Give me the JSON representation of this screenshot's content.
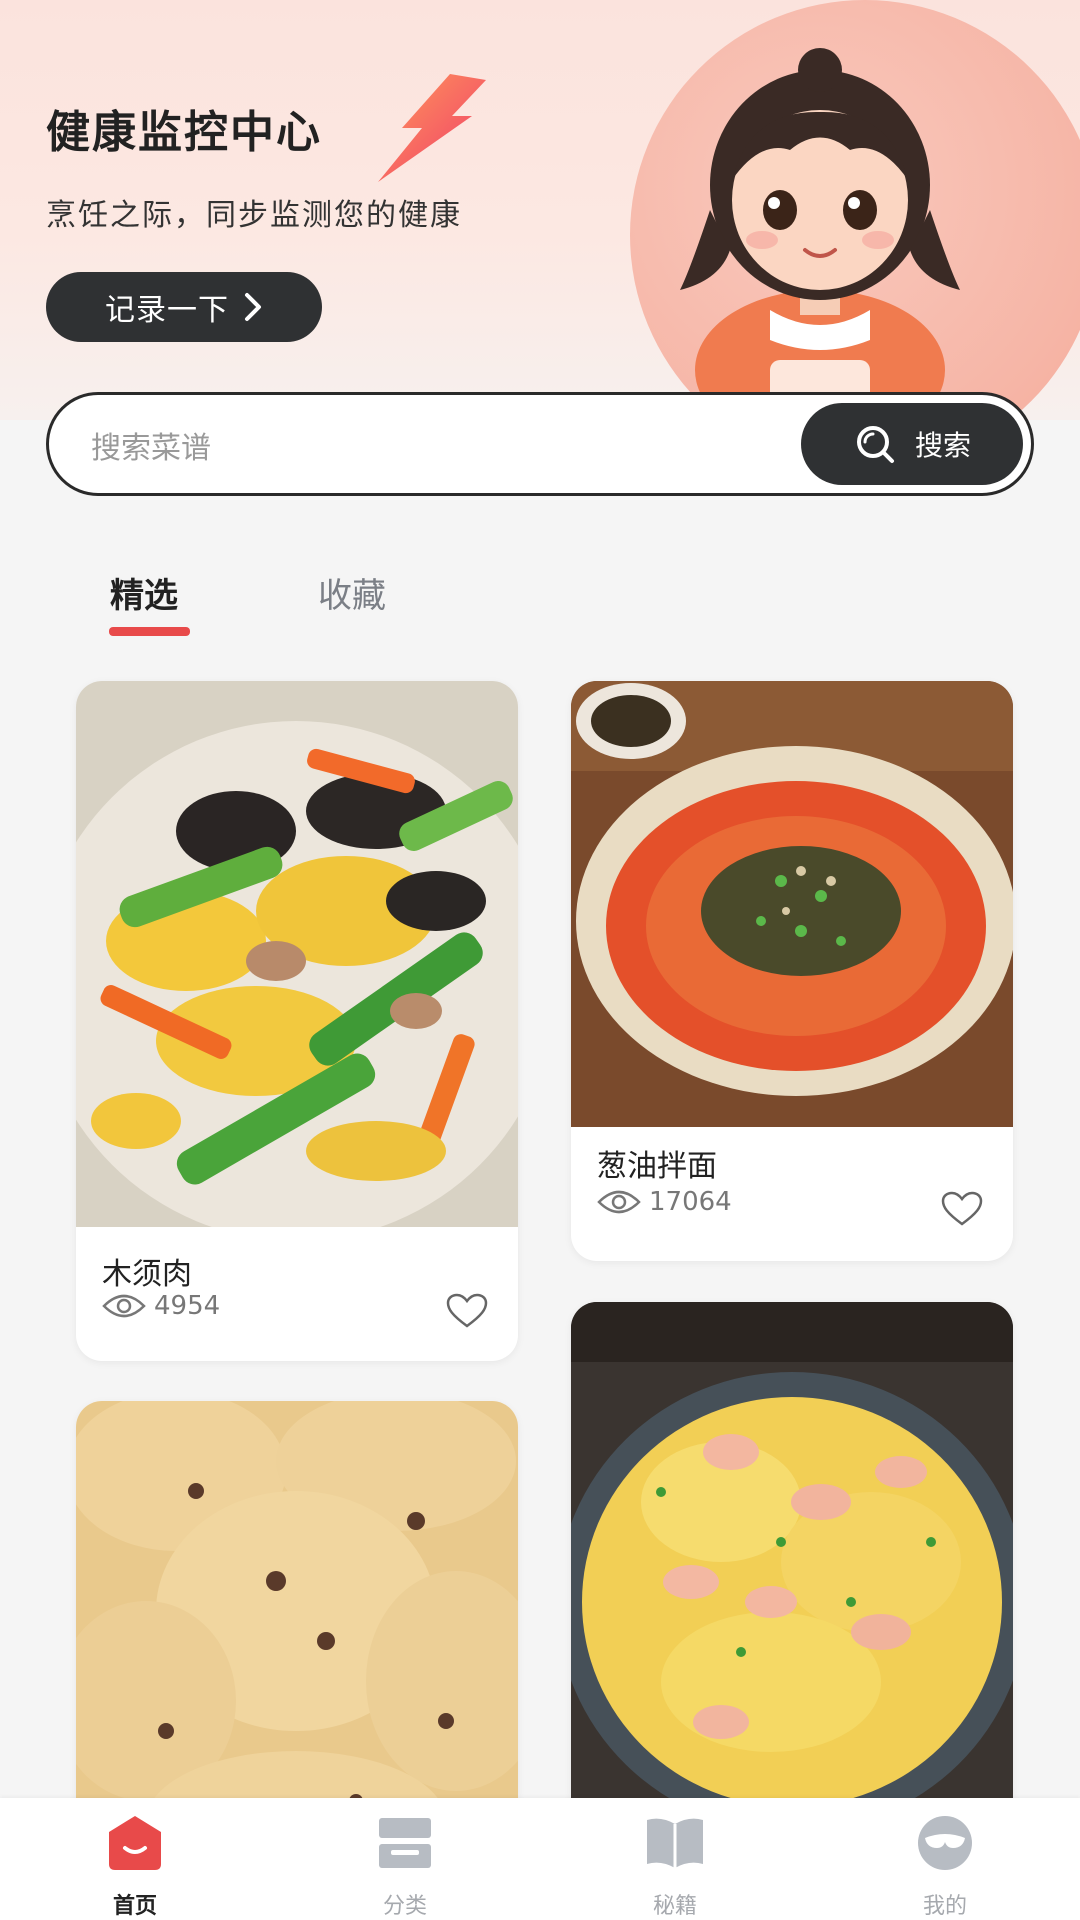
{
  "hero": {
    "title": "健康监控中心",
    "subtitle": "烹饪之际，同步监测您的健康",
    "record_button": "记录一下"
  },
  "search": {
    "placeholder": "搜索菜谱",
    "button_label": "搜索"
  },
  "tabs": [
    {
      "label": "精选",
      "active": true
    },
    {
      "label": "收藏",
      "active": false
    }
  ],
  "recipes": [
    {
      "name": "木须肉",
      "views": "4954"
    },
    {
      "name": "葱油拌面",
      "views": "17064"
    },
    {
      "name": "",
      "views": ""
    },
    {
      "name": "",
      "views": ""
    }
  ],
  "bottom_nav": [
    {
      "label": "首页",
      "icon": "home-icon",
      "active": true
    },
    {
      "label": "分类",
      "icon": "category-icon",
      "active": false
    },
    {
      "label": "秘籍",
      "icon": "book-icon",
      "active": false
    },
    {
      "label": "我的",
      "icon": "profile-icon",
      "active": false
    }
  ],
  "colors": {
    "accent": "#e84a4a",
    "dark_button": "#2f3133",
    "background": "#f5f5f5"
  }
}
